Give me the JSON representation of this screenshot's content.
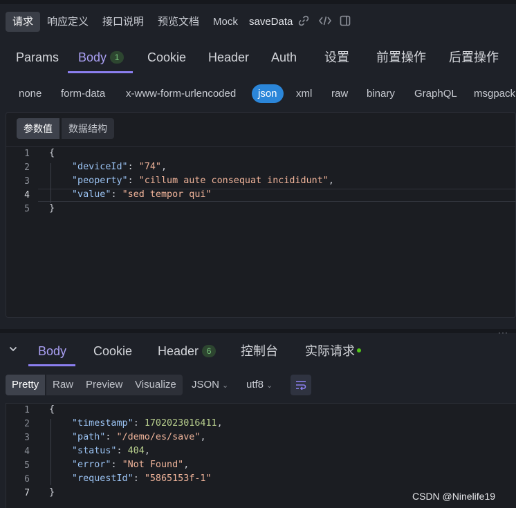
{
  "top_tabs": [
    "请求",
    "响应定义",
    "接口说明",
    "预览文档",
    "Mock"
  ],
  "api_name": "saveData",
  "tool_icons": [
    "link-icon",
    "code-icon",
    "panel-icon"
  ],
  "request_tabs": [
    {
      "label": "Params"
    },
    {
      "label": "Body",
      "badge": "1"
    },
    {
      "label": "Cookie"
    },
    {
      "label": "Header"
    },
    {
      "label": "Auth"
    },
    {
      "label": "设置"
    },
    {
      "label": "前置操作"
    },
    {
      "label": "后置操作"
    }
  ],
  "body_types": [
    "none",
    "form-data",
    "x-www-form-urlencoded",
    "json",
    "xml",
    "raw",
    "binary",
    "GraphQL",
    "msgpack"
  ],
  "active_body_type": "json",
  "body_sub_tabs": [
    "参数值",
    "数据结构"
  ],
  "request_code": {
    "line_numbers": [
      "1",
      "2",
      "3",
      "4",
      "5"
    ],
    "open": "{",
    "close": "}",
    "fields": [
      {
        "key": "\"deviceId\"",
        "value": "\"74\""
      },
      {
        "key": "\"peoperty\"",
        "value": "\"cillum aute consequat incididunt\""
      },
      {
        "key": "\"value\"",
        "value": "\"sed tempor qui\""
      }
    ]
  },
  "response_tabs": [
    {
      "label": "Body"
    },
    {
      "label": "Cookie"
    },
    {
      "label": "Header",
      "badge": "6"
    },
    {
      "label": "控制台"
    },
    {
      "label": "实际请求"
    }
  ],
  "view_modes": [
    "Pretty",
    "Raw",
    "Preview",
    "Visualize"
  ],
  "format_select": "JSON",
  "encoding_select": "utf8",
  "response_code": {
    "line_numbers": [
      "1",
      "2",
      "3",
      "4",
      "5",
      "6",
      "7"
    ],
    "open": "{",
    "close": "}",
    "fields": [
      {
        "key": "\"timestamp\"",
        "value": "1702023016411",
        "type": "number"
      },
      {
        "key": "\"path\"",
        "value": "\"/demo/es/save\"",
        "type": "string"
      },
      {
        "key": "\"status\"",
        "value": "404",
        "type": "number"
      },
      {
        "key": "\"error\"",
        "value": "\"Not Found\"",
        "type": "string"
      },
      {
        "key": "\"requestId\"",
        "value": "\"5865153f-1\"",
        "type": "string"
      }
    ]
  },
  "watermark": "CSDN @Ninelife19",
  "colors": {
    "accent": "#8b7ff0",
    "json_active": "#2b86d9",
    "key": "#9bc3f3",
    "string": "#f0b49a",
    "number": "#bad18f",
    "status_dot": "#52c41a"
  }
}
